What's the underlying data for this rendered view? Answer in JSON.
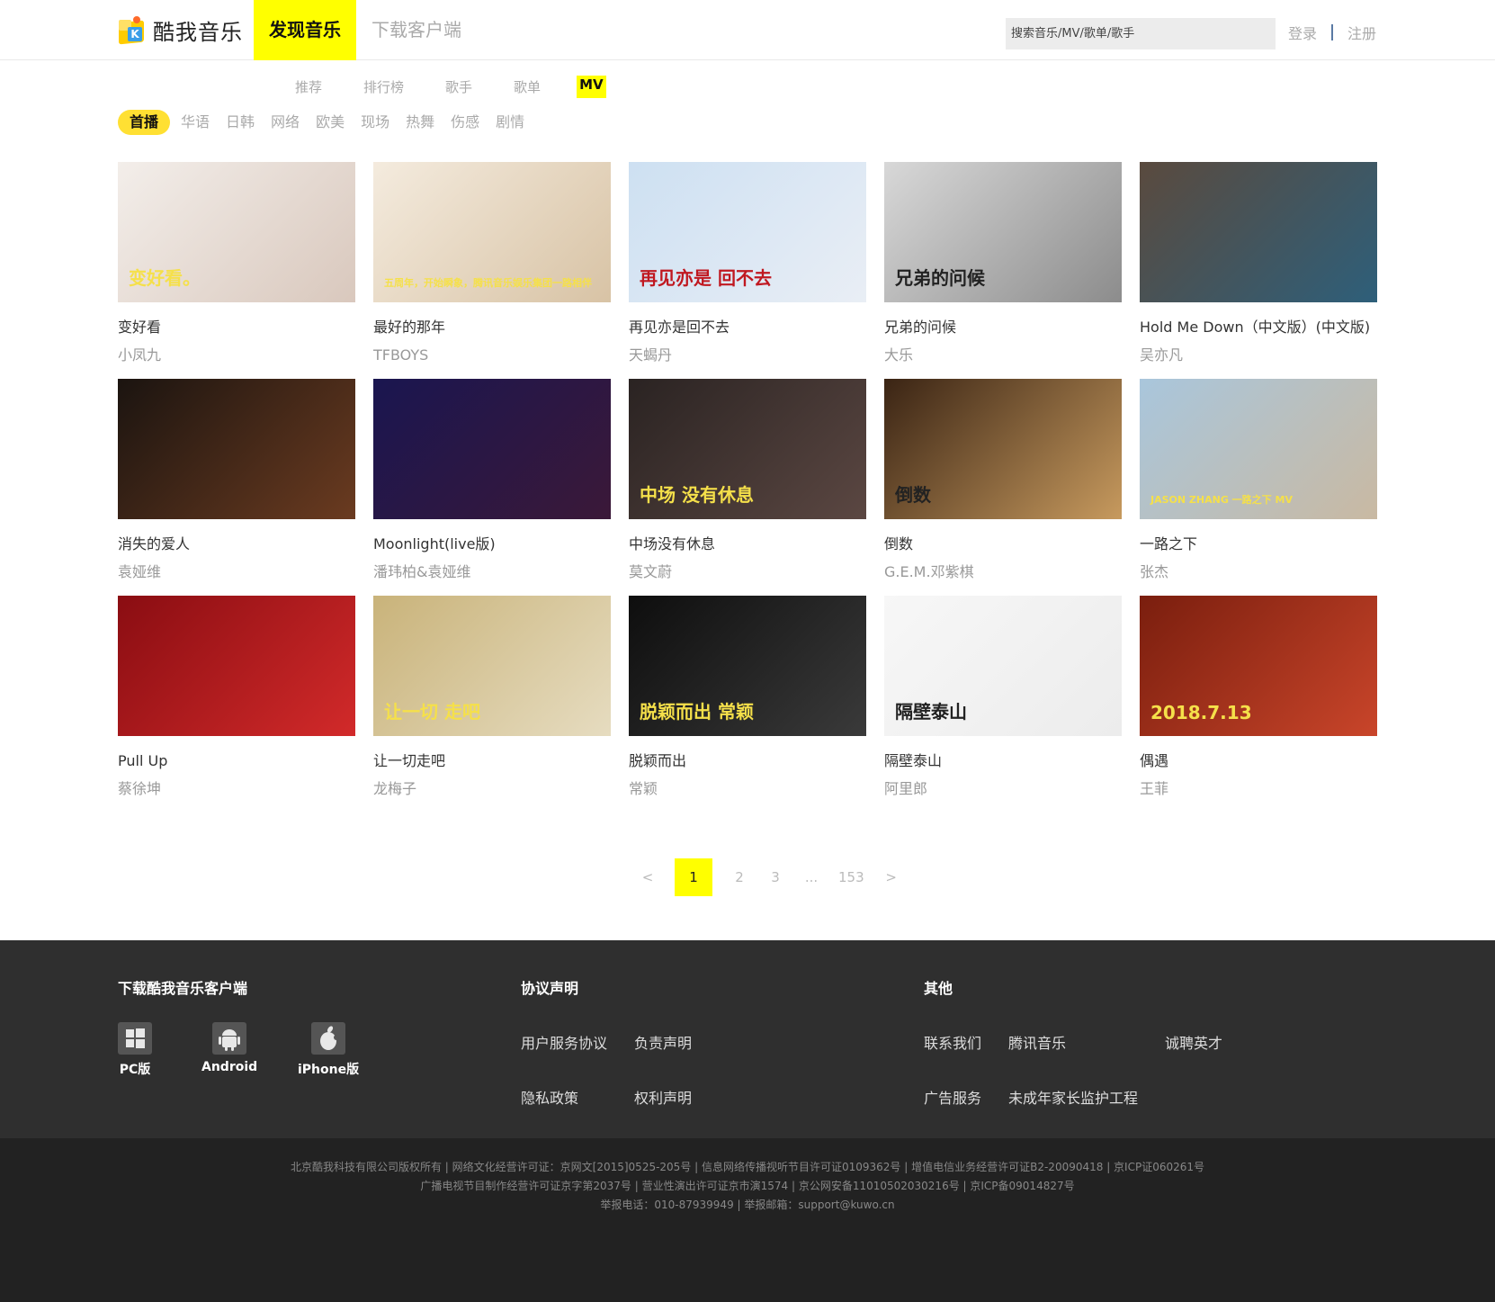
{
  "header": {
    "brand": "酷我音乐",
    "nav": [
      {
        "label": "发现音乐",
        "active": true
      },
      {
        "label": "下载客户端",
        "active": false
      }
    ],
    "search_placeholder": "搜索音乐/MV/歌单/歌手",
    "login": "登录",
    "register": "注册"
  },
  "subnav": [
    "推荐",
    "排行榜",
    "歌手",
    "歌单",
    "MV"
  ],
  "subnav_active": "MV",
  "categories": [
    "首播",
    "华语",
    "日韩",
    "网络",
    "欧美",
    "现场",
    "热舞",
    "伤感",
    "剧情"
  ],
  "category_active": "首播",
  "mvs": [
    {
      "title": "变好看",
      "artist": "小凤九",
      "thumb_text": "变好看。",
      "colors": [
        "#f3eeea",
        "#d9c8bd"
      ]
    },
    {
      "title": "最好的那年",
      "artist": "TFBOYS",
      "thumb_text": "五周年，开始瞬象，腾讯音乐娱乐集团一路相伴",
      "colors": [
        "#f4ebde",
        "#d8c3a5"
      ]
    },
    {
      "title": "再见亦是回不去",
      "artist": "天蝎丹",
      "thumb_text": "再见亦是 回不去",
      "colors": [
        "#cde0f2",
        "#e9eef5"
      ]
    },
    {
      "title": "兄弟的问候",
      "artist": "大乐",
      "thumb_text": "兄弟的问候",
      "colors": [
        "#d8d8d8",
        "#8c8c8c"
      ]
    },
    {
      "title": "Hold Me Down（中文版）(中文版)",
      "artist": "吴亦凡",
      "thumb_text": "",
      "colors": [
        "#5a4a3e",
        "#2e5f7a"
      ]
    },
    {
      "title": "消失的爱人",
      "artist": "袁娅维",
      "thumb_text": "",
      "colors": [
        "#1b1410",
        "#6b3b20"
      ]
    },
    {
      "title": "Moonlight(live版)",
      "artist": "潘玮柏&袁娅维",
      "thumb_text": "",
      "colors": [
        "#1a1650",
        "#3b1838"
      ]
    },
    {
      "title": "中场没有休息",
      "artist": "莫文蔚",
      "thumb_text": "中场 没有休息",
      "colors": [
        "#2a2322",
        "#5b4742"
      ]
    },
    {
      "title": "倒数",
      "artist": "G.E.M.邓紫棋",
      "thumb_text": "倒数",
      "colors": [
        "#3a2414",
        "#c79a5e"
      ]
    },
    {
      "title": "一路之下",
      "artist": "张杰",
      "thumb_text": "JASON ZHANG 一路之下 MV",
      "colors": [
        "#a9c6dc",
        "#c9b9a2"
      ]
    },
    {
      "title": "Pull Up",
      "artist": "蔡徐坤",
      "thumb_text": "",
      "colors": [
        "#8a0d12",
        "#d22a2a"
      ]
    },
    {
      "title": "让一切走吧",
      "artist": "龙梅子",
      "thumb_text": "让一切 走吧",
      "colors": [
        "#c9b37a",
        "#e6dcc0"
      ]
    },
    {
      "title": "脱颖而出",
      "artist": "常颖",
      "thumb_text": "脱颖而出 常颖",
      "colors": [
        "#0e0e0e",
        "#3a3a3a"
      ]
    },
    {
      "title": "隔壁泰山",
      "artist": "阿里郎",
      "thumb_text": "隔壁泰山",
      "colors": [
        "#f7f7f7",
        "#ececec"
      ]
    },
    {
      "title": "偶遇",
      "artist": "王菲",
      "thumb_text": "2018.7.13",
      "colors": [
        "#7a1e0e",
        "#c9452a"
      ]
    }
  ],
  "pagination": {
    "prev": "<",
    "pages": [
      "1",
      "2",
      "3",
      "...",
      "153"
    ],
    "current": "1",
    "next": ">"
  },
  "footer": {
    "download_title": "下载酷我音乐客户端",
    "downloads": [
      {
        "label": "PC版",
        "icon": "windows-icon"
      },
      {
        "label": "Android",
        "icon": "android-icon"
      },
      {
        "label": "iPhone版",
        "icon": "apple-icon"
      }
    ],
    "protocol_title": "协议声明",
    "protocol_links": [
      "用户服务协议",
      "负责声明",
      "隐私政策",
      "权利声明"
    ],
    "other_title": "其他",
    "other_links": [
      "联系我们",
      "腾讯音乐",
      "诚聘英才",
      "广告服务",
      "未成年家长监护工程"
    ]
  },
  "copyright": [
    "北京酷我科技有限公司版权所有 | 网络文化经营许可证：京网文[2015]0525-205号 | 信息网络传播视听节目许可证0109362号 | 增值电信业务经营许可证B2-20090418 | 京ICP证060261号",
    "广播电视节目制作经营许可证京字第2037号 | 营业性演出许可证京市演1574 | 京公网安备11010502030216号 | 京ICP备09014827号",
    "举报电话：010-87939949 | 举报邮箱：support@kuwo.cn"
  ]
}
